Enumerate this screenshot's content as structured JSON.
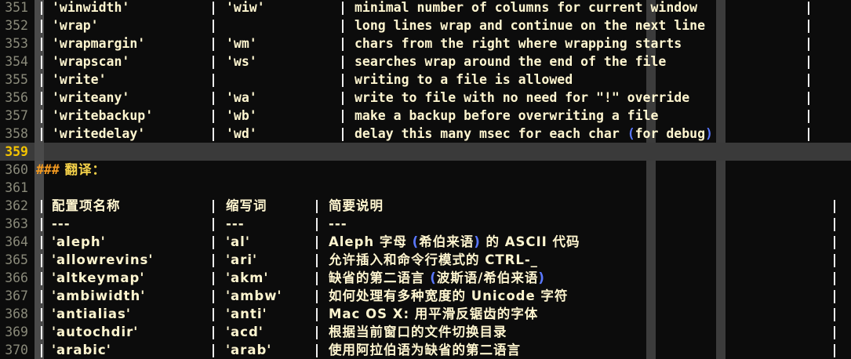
{
  "editor": {
    "lines": [
      {
        "num": "351",
        "kind": "opt",
        "c1": "'winwidth'",
        "c2": "'wiw'",
        "c3": "minimal number of columns for current window"
      },
      {
        "num": "352",
        "kind": "opt",
        "c1": "'wrap'",
        "c2": "",
        "c3": "long lines wrap and continue on the next line"
      },
      {
        "num": "353",
        "kind": "opt",
        "c1": "'wrapmargin'",
        "c2": "'wm'",
        "c3": "chars from the right where wrapping starts"
      },
      {
        "num": "354",
        "kind": "opt",
        "c1": "'wrapscan'",
        "c2": "'ws'",
        "c3": "searches wrap around the end of the file"
      },
      {
        "num": "355",
        "kind": "opt",
        "c1": "'write'",
        "c2": "",
        "c3": "writing to a file is allowed"
      },
      {
        "num": "356",
        "kind": "opt",
        "c1": "'writeany'",
        "c2": "'wa'",
        "c3": "write to file with no need for \"!\" override"
      },
      {
        "num": "357",
        "kind": "opt",
        "c1": "'writebackup'",
        "c2": "'wb'",
        "c3": "make a backup before overwriting a file"
      },
      {
        "num": "358",
        "kind": "opt",
        "c1": "'writedelay'",
        "c2": "'wd'",
        "c3a": "delay this many msec for each char ",
        "c3p1": "(",
        "c3b": "for debug",
        "c3p2": ")"
      },
      {
        "num": "359",
        "kind": "cursor"
      },
      {
        "num": "360",
        "kind": "heading",
        "hash": "###",
        "title": " 翻译："
      },
      {
        "num": "361",
        "kind": "blank"
      },
      {
        "num": "362",
        "kind": "zh",
        "c1": "配置项名称",
        "c2": "缩写词",
        "c3": "简要说明"
      },
      {
        "num": "363",
        "kind": "zh",
        "c1": "---",
        "c2": "---",
        "c3": "---"
      },
      {
        "num": "364",
        "kind": "zhp",
        "c1": "'aleph'",
        "c2": "'al'",
        "c3a": "Aleph 字母 ",
        "c3p1": "(",
        "c3b": "希伯来语",
        "c3p2": ")",
        "c3c": " 的 ASCII 代码"
      },
      {
        "num": "365",
        "kind": "zh",
        "c1": "'allowrevins'",
        "c2": "'ari'",
        "c3": "允许插入和命令行模式的 CTRL-_"
      },
      {
        "num": "366",
        "kind": "zhp",
        "c1": "'altkeymap'",
        "c2": "'akm'",
        "c3a": "缺省的第二语言 ",
        "c3p1": "(",
        "c3b": "波斯语/希伯来语",
        "c3p2": ")",
        "c3c": ""
      },
      {
        "num": "367",
        "kind": "zh",
        "c1": "'ambiwidth'",
        "c2": "'ambw'",
        "c3": "如何处理有多种宽度的 Unicode 字符"
      },
      {
        "num": "368",
        "kind": "zh",
        "c1": "'antialias'",
        "c2": "'anti'",
        "c3": "Mac OS X: 用平滑反锯齿的字体"
      },
      {
        "num": "369",
        "kind": "zh",
        "c1": "'autochdir'",
        "c2": "'acd'",
        "c3": "根据当前窗口的文件切换目录"
      },
      {
        "num": "370",
        "kind": "zh",
        "c1": "'arabic'",
        "c2": "'arab'",
        "c3": "使用阿拉伯语为缺省的第二语言"
      }
    ]
  },
  "colors": {
    "background": "#0c0c0c",
    "text": "#fff6d0",
    "line_number": "#8a8a7a",
    "cursor_line": "#3a3a3a",
    "heading_hash": "#f39a20",
    "paren": "#5a78ff"
  }
}
